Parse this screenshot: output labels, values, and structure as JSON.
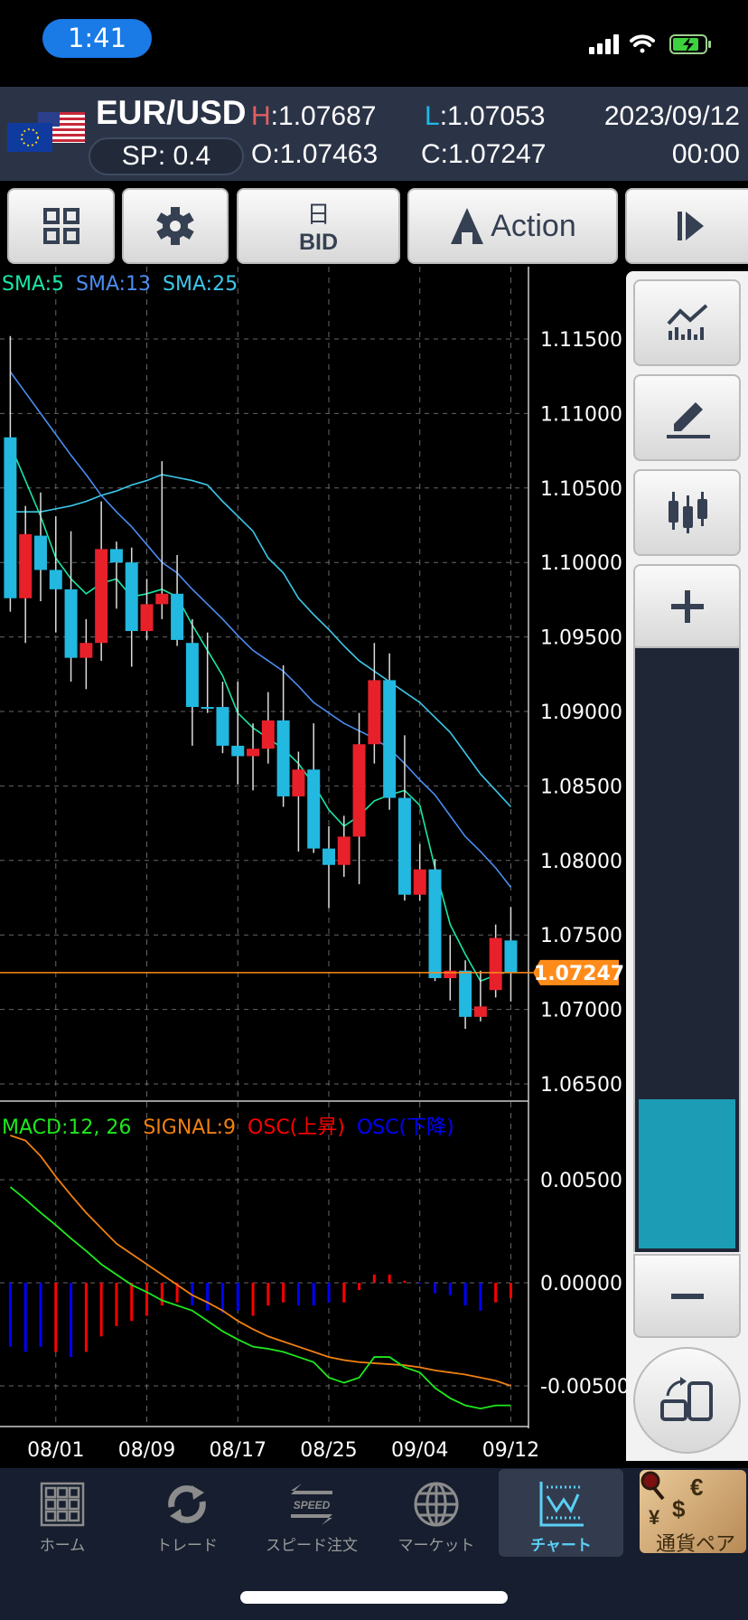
{
  "status_bar": {
    "time": "1:41"
  },
  "header": {
    "pair": "EUR/USD",
    "spread": "SP: 0.4",
    "high_label": "H",
    "high": "1.07687",
    "low_label": "L",
    "low": "1.07053",
    "open_label": "O",
    "open": "1.07463",
    "close_label": "C",
    "close": "1.07247",
    "date": "2023/09/12",
    "time": "00:00"
  },
  "toolbar": {
    "period": "日",
    "price_type": "BID",
    "action": "Action"
  },
  "legend": {
    "sma5": "SMA:5",
    "sma13": "SMA:13",
    "sma25": "SMA:25",
    "macd": "MACD:12, 26",
    "signal": "SIGNAL:9",
    "osc_up": "OSC(上昇)",
    "osc_down": "OSC(下降)"
  },
  "colors": {
    "sma5": "#19e6a8",
    "sma13": "#4a8df0",
    "sma25": "#3cc8ea",
    "up": "#e8202a",
    "down": "#22b8e0",
    "macd": "#1ee81e",
    "signal": "#f08010",
    "osc_up": "#ff0000",
    "osc_down": "#0000ff",
    "current": "#ff8c1a"
  },
  "side_panel": {
    "zoom_level": 0.25
  },
  "chart_data": [
    {
      "type": "candlestick",
      "y_ticks": [
        "1.11500",
        "1.11000",
        "1.10500",
        "1.10000",
        "1.09500",
        "1.09000",
        "1.08500",
        "1.08000",
        "1.07500",
        "1.07000",
        "1.06500"
      ],
      "ylim": [
        1.065,
        1.115
      ],
      "x_tick_labels": [
        "08/01",
        "08/09",
        "08/17",
        "08/25",
        "09/04",
        "09/12"
      ],
      "x_tick_index": [
        3,
        9,
        15,
        21,
        27,
        33
      ],
      "current_price": "1.07247",
      "ohlc": [
        [
          1.1084,
          1.1152,
          1.0967,
          1.0976
        ],
        [
          1.0976,
          1.1038,
          1.0946,
          1.1019
        ],
        [
          1.1018,
          1.1047,
          1.0974,
          1.0995
        ],
        [
          1.0995,
          1.1031,
          1.0953,
          1.0982
        ],
        [
          1.0982,
          1.1021,
          1.092,
          1.0936
        ],
        [
          1.0936,
          1.0962,
          1.0915,
          1.0946
        ],
        [
          1.0946,
          1.1041,
          1.0934,
          1.1009
        ],
        [
          1.1009,
          1.1014,
          1.0969,
          1.1
        ],
        [
          1.1,
          1.101,
          1.093,
          1.0954
        ],
        [
          1.0954,
          1.0989,
          1.0948,
          1.0972
        ],
        [
          1.0972,
          1.1068,
          1.0962,
          1.0979
        ],
        [
          1.0979,
          1.1005,
          1.0944,
          1.0948
        ],
        [
          1.0946,
          1.0962,
          1.0877,
          1.0903
        ],
        [
          1.0903,
          1.0953,
          1.0899,
          1.0902
        ],
        [
          1.0903,
          1.092,
          1.0872,
          1.0877
        ],
        [
          1.0877,
          1.092,
          1.0851,
          1.087
        ],
        [
          1.087,
          1.0892,
          1.0847,
          1.0875
        ],
        [
          1.0875,
          1.0913,
          1.0865,
          1.0894
        ],
        [
          1.0894,
          1.0931,
          1.0836,
          1.0843
        ],
        [
          1.0843,
          1.0873,
          1.0806,
          1.0861
        ],
        [
          1.0861,
          1.0892,
          1.0805,
          1.0808
        ],
        [
          1.0808,
          1.0823,
          1.0768,
          1.0797
        ],
        [
          1.0797,
          1.083,
          1.0789,
          1.0816
        ],
        [
          1.0816,
          1.0899,
          1.0784,
          1.0878
        ],
        [
          1.0878,
          1.0946,
          1.0865,
          1.0921
        ],
        [
          1.0921,
          1.0939,
          1.0834,
          1.0842
        ],
        [
          1.0842,
          1.0884,
          1.0773,
          1.0777
        ],
        [
          1.0777,
          1.0811,
          1.0773,
          1.0794
        ],
        [
          1.0794,
          1.0801,
          1.0719,
          1.0721
        ],
        [
          1.0721,
          1.075,
          1.0706,
          1.0726
        ],
        [
          1.0726,
          1.0733,
          1.0687,
          1.0695
        ],
        [
          1.0695,
          1.0726,
          1.0692,
          1.0702
        ],
        [
          1.0713,
          1.0757,
          1.0708,
          1.0748
        ],
        [
          1.07463,
          1.07687,
          1.07053,
          1.07247
        ]
      ],
      "sma5": [
        1.1079,
        1.1055,
        1.1031,
        1.1003,
        1.0989,
        1.0979,
        1.0986,
        1.0989,
        1.0977,
        1.0979,
        1.0982,
        1.0977,
        1.0958,
        1.0941,
        1.0924,
        1.0899,
        1.0889,
        1.0882,
        1.0875,
        1.0865,
        1.0851,
        1.0834,
        1.0823,
        1.083,
        1.084,
        1.0844,
        1.0847,
        1.0837,
        1.0795,
        1.0757,
        1.0737,
        1.0719,
        1.0723,
        1.0726
      ],
      "sma13": [
        1.1128,
        1.1114,
        1.11,
        1.1086,
        1.1072,
        1.1059,
        1.1045,
        1.1034,
        1.1024,
        1.1012,
        1.1,
        1.0993,
        1.0982,
        1.0972,
        1.0962,
        1.0951,
        1.0941,
        1.0934,
        1.0927,
        1.0917,
        1.0906,
        1.0899,
        1.0892,
        1.0887,
        1.0882,
        1.0875,
        1.0865,
        1.0854,
        1.0844,
        1.083,
        1.0816,
        1.0806,
        1.0795,
        1.0782
      ],
      "sma25": [
        1.1034,
        1.1034,
        1.1034,
        1.1036,
        1.1038,
        1.1041,
        1.1045,
        1.1048,
        1.1052,
        1.1055,
        1.1059,
        1.1057,
        1.1055,
        1.1052,
        1.1041,
        1.1031,
        1.1021,
        1.1003,
        1.0993,
        1.0976,
        1.0965,
        1.0955,
        1.0944,
        1.0934,
        1.0927,
        1.092,
        1.0913,
        1.0906,
        1.0896,
        1.0886,
        1.0872,
        1.0858,
        1.0847,
        1.0836
      ]
    },
    {
      "type": "macd",
      "y_ticks": [
        "0.00500",
        "0.00000",
        "-0.00500"
      ],
      "ylim": [
        -0.0069,
        0.0085
      ],
      "macd": [
        0.00465,
        0.00405,
        0.0034,
        0.0028,
        0.00215,
        0.00155,
        0.0009,
        0.0004,
        -0.0001,
        -0.00045,
        -0.00085,
        -0.0011,
        -0.00135,
        -0.00185,
        -0.00235,
        -0.00275,
        -0.0031,
        -0.0032,
        -0.00335,
        -0.0036,
        -0.00385,
        -0.0046,
        -0.00485,
        -0.0046,
        -0.0036,
        -0.0036,
        -0.0041,
        -0.00435,
        -0.0051,
        -0.0056,
        -0.00595,
        -0.0061,
        -0.00595,
        -0.00595
      ],
      "signal": [
        0.00715,
        0.0069,
        0.00615,
        0.00515,
        0.00425,
        0.0034,
        0.00265,
        0.0019,
        0.0014,
        0.0009,
        0.0004,
        -0.0001,
        -0.0006,
        -0.00095,
        -0.00135,
        -0.00185,
        -0.00225,
        -0.0026,
        -0.00285,
        -0.0031,
        -0.00335,
        -0.0036,
        -0.00375,
        -0.00385,
        -0.0039,
        -0.00395,
        -0.004,
        -0.0041,
        -0.00425,
        -0.00435,
        -0.00445,
        -0.0046,
        -0.00475,
        -0.005
      ],
      "osc": [
        -0.0031,
        -0.00335,
        -0.0031,
        -0.00335,
        -0.0036,
        -0.00335,
        -0.0026,
        -0.0021,
        -0.00185,
        -0.0016,
        -0.0011,
        -0.00095,
        -0.0011,
        -0.00135,
        -0.00145,
        -0.00135,
        -0.0016,
        -0.0011,
        -0.00095,
        -0.0011,
        -0.0011,
        -0.00095,
        -0.00095,
        -0.00035,
        0.0004,
        0.0004,
        0.0001,
        0,
        -0.0005,
        -0.0006,
        -0.0011,
        -0.00135,
        -0.00095,
        -0.00075
      ],
      "osc_direction": [
        "down",
        "down",
        "down",
        "up",
        "down",
        "up",
        "up",
        "up",
        "up",
        "up",
        "up",
        "up",
        "down",
        "down",
        "down",
        "down",
        "up",
        "up",
        "up",
        "down",
        "down",
        "down",
        "up",
        "up",
        "up",
        "up",
        "up",
        "down",
        "down",
        "down",
        "down",
        "down",
        "up",
        "up"
      ]
    }
  ],
  "nav": {
    "items": [
      {
        "label": "ホーム"
      },
      {
        "label": "トレード"
      },
      {
        "label": "スピード注文",
        "icon_text": "SPEED"
      },
      {
        "label": "マーケット"
      },
      {
        "label": "チャート"
      }
    ],
    "currency_pair": {
      "label": "通貨ペア",
      "symbols": [
        "€",
        "$",
        "¥"
      ]
    }
  }
}
